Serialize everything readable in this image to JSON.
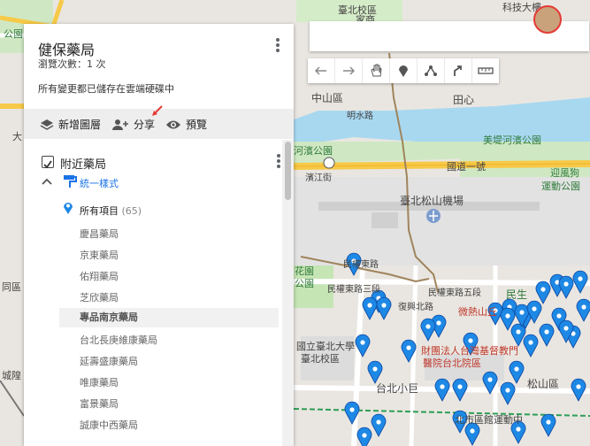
{
  "map_name": "健保藥局",
  "views": "瀏覽次數：1 次",
  "saved": "所有變更都已儲存在雲端硬碟中",
  "toolbar": {
    "add_layer": "新增圖層",
    "share": "分享",
    "preview": "預覽"
  },
  "layer": {
    "name": "附近藥局",
    "style_label": "統一樣式",
    "all_items": "所有項目",
    "count": "(65)",
    "items": [
      "慶昌藥局",
      "京東藥局",
      "佑翔藥局",
      "芝欣藥局",
      "專品南京藥局",
      "台北長庚維康藥局",
      "延壽盛康藥局",
      "唯康藥局",
      "富景藥局",
      "誠康中西藥局"
    ],
    "selected_index": 4
  },
  "map_labels": {
    "north_school": "臺北校區",
    "tech_building": "科技大樓",
    "zhongshan": "中山區",
    "mingshui": "明水路",
    "tianxin": "田心",
    "river_park_1": "美堤河濱公園",
    "river_park_2": "河濱公園",
    "guoyi": "國道一號",
    "yingfeng_1": "迎風狗",
    "yingfeng_2": "運動公園",
    "binjiang": "濱江街",
    "airport": "臺北松山機場",
    "minquan": "民權東路三段",
    "minquan2": "民權東路",
    "minquan5": "民權東路五段",
    "minsheng": "民生",
    "weifeng": "微熱山丘",
    "hospital_1": "財團法人台灣基督教門",
    "hospital_2": "醫院台北院區",
    "taipei_campus_1": "國立臺北大學",
    "taipei_campus_2": "臺北校區",
    "xiaojudan": "台北小巨",
    "songshan": "松山區",
    "sports": "北市區館運動中",
    "park_1": "花園",
    "park_2": "公園",
    "tong": "同區",
    "chengfang": "城隍",
    "dalu": "大",
    "fuxing": "復興北路",
    "gonggong": "公園",
    "jiachang": "家商"
  },
  "colors": {
    "accent": "#1a73e8",
    "pin": "#1e88e5",
    "road": "#f7c948",
    "water": "#a8d8f0",
    "park": "#c6e5b5"
  }
}
